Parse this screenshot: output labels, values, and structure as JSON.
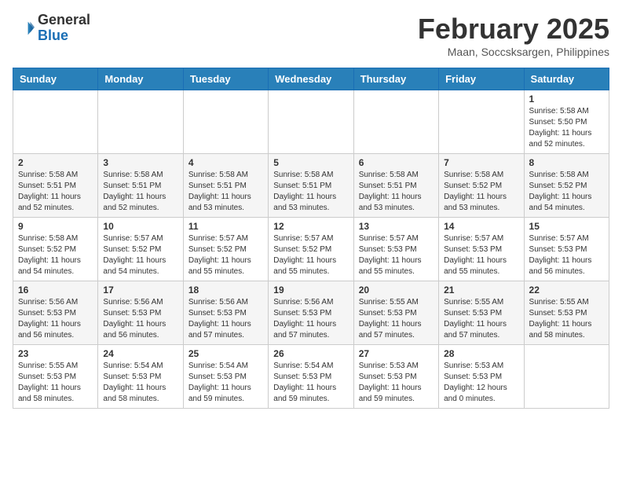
{
  "header": {
    "logo_general": "General",
    "logo_blue": "Blue",
    "month_title": "February 2025",
    "location": "Maan, Soccsksargen, Philippines"
  },
  "weekdays": [
    "Sunday",
    "Monday",
    "Tuesday",
    "Wednesday",
    "Thursday",
    "Friday",
    "Saturday"
  ],
  "weeks": [
    [
      {
        "day": "",
        "info": ""
      },
      {
        "day": "",
        "info": ""
      },
      {
        "day": "",
        "info": ""
      },
      {
        "day": "",
        "info": ""
      },
      {
        "day": "",
        "info": ""
      },
      {
        "day": "",
        "info": ""
      },
      {
        "day": "1",
        "info": "Sunrise: 5:58 AM\nSunset: 5:50 PM\nDaylight: 11 hours\nand 52 minutes."
      }
    ],
    [
      {
        "day": "2",
        "info": "Sunrise: 5:58 AM\nSunset: 5:51 PM\nDaylight: 11 hours\nand 52 minutes."
      },
      {
        "day": "3",
        "info": "Sunrise: 5:58 AM\nSunset: 5:51 PM\nDaylight: 11 hours\nand 52 minutes."
      },
      {
        "day": "4",
        "info": "Sunrise: 5:58 AM\nSunset: 5:51 PM\nDaylight: 11 hours\nand 53 minutes."
      },
      {
        "day": "5",
        "info": "Sunrise: 5:58 AM\nSunset: 5:51 PM\nDaylight: 11 hours\nand 53 minutes."
      },
      {
        "day": "6",
        "info": "Sunrise: 5:58 AM\nSunset: 5:51 PM\nDaylight: 11 hours\nand 53 minutes."
      },
      {
        "day": "7",
        "info": "Sunrise: 5:58 AM\nSunset: 5:52 PM\nDaylight: 11 hours\nand 53 minutes."
      },
      {
        "day": "8",
        "info": "Sunrise: 5:58 AM\nSunset: 5:52 PM\nDaylight: 11 hours\nand 54 minutes."
      }
    ],
    [
      {
        "day": "9",
        "info": "Sunrise: 5:58 AM\nSunset: 5:52 PM\nDaylight: 11 hours\nand 54 minutes."
      },
      {
        "day": "10",
        "info": "Sunrise: 5:57 AM\nSunset: 5:52 PM\nDaylight: 11 hours\nand 54 minutes."
      },
      {
        "day": "11",
        "info": "Sunrise: 5:57 AM\nSunset: 5:52 PM\nDaylight: 11 hours\nand 55 minutes."
      },
      {
        "day": "12",
        "info": "Sunrise: 5:57 AM\nSunset: 5:52 PM\nDaylight: 11 hours\nand 55 minutes."
      },
      {
        "day": "13",
        "info": "Sunrise: 5:57 AM\nSunset: 5:53 PM\nDaylight: 11 hours\nand 55 minutes."
      },
      {
        "day": "14",
        "info": "Sunrise: 5:57 AM\nSunset: 5:53 PM\nDaylight: 11 hours\nand 55 minutes."
      },
      {
        "day": "15",
        "info": "Sunrise: 5:57 AM\nSunset: 5:53 PM\nDaylight: 11 hours\nand 56 minutes."
      }
    ],
    [
      {
        "day": "16",
        "info": "Sunrise: 5:56 AM\nSunset: 5:53 PM\nDaylight: 11 hours\nand 56 minutes."
      },
      {
        "day": "17",
        "info": "Sunrise: 5:56 AM\nSunset: 5:53 PM\nDaylight: 11 hours\nand 56 minutes."
      },
      {
        "day": "18",
        "info": "Sunrise: 5:56 AM\nSunset: 5:53 PM\nDaylight: 11 hours\nand 57 minutes."
      },
      {
        "day": "19",
        "info": "Sunrise: 5:56 AM\nSunset: 5:53 PM\nDaylight: 11 hours\nand 57 minutes."
      },
      {
        "day": "20",
        "info": "Sunrise: 5:55 AM\nSunset: 5:53 PM\nDaylight: 11 hours\nand 57 minutes."
      },
      {
        "day": "21",
        "info": "Sunrise: 5:55 AM\nSunset: 5:53 PM\nDaylight: 11 hours\nand 57 minutes."
      },
      {
        "day": "22",
        "info": "Sunrise: 5:55 AM\nSunset: 5:53 PM\nDaylight: 11 hours\nand 58 minutes."
      }
    ],
    [
      {
        "day": "23",
        "info": "Sunrise: 5:55 AM\nSunset: 5:53 PM\nDaylight: 11 hours\nand 58 minutes."
      },
      {
        "day": "24",
        "info": "Sunrise: 5:54 AM\nSunset: 5:53 PM\nDaylight: 11 hours\nand 58 minutes."
      },
      {
        "day": "25",
        "info": "Sunrise: 5:54 AM\nSunset: 5:53 PM\nDaylight: 11 hours\nand 59 minutes."
      },
      {
        "day": "26",
        "info": "Sunrise: 5:54 AM\nSunset: 5:53 PM\nDaylight: 11 hours\nand 59 minutes."
      },
      {
        "day": "27",
        "info": "Sunrise: 5:53 AM\nSunset: 5:53 PM\nDaylight: 11 hours\nand 59 minutes."
      },
      {
        "day": "28",
        "info": "Sunrise: 5:53 AM\nSunset: 5:53 PM\nDaylight: 12 hours\nand 0 minutes."
      },
      {
        "day": "",
        "info": ""
      }
    ]
  ]
}
